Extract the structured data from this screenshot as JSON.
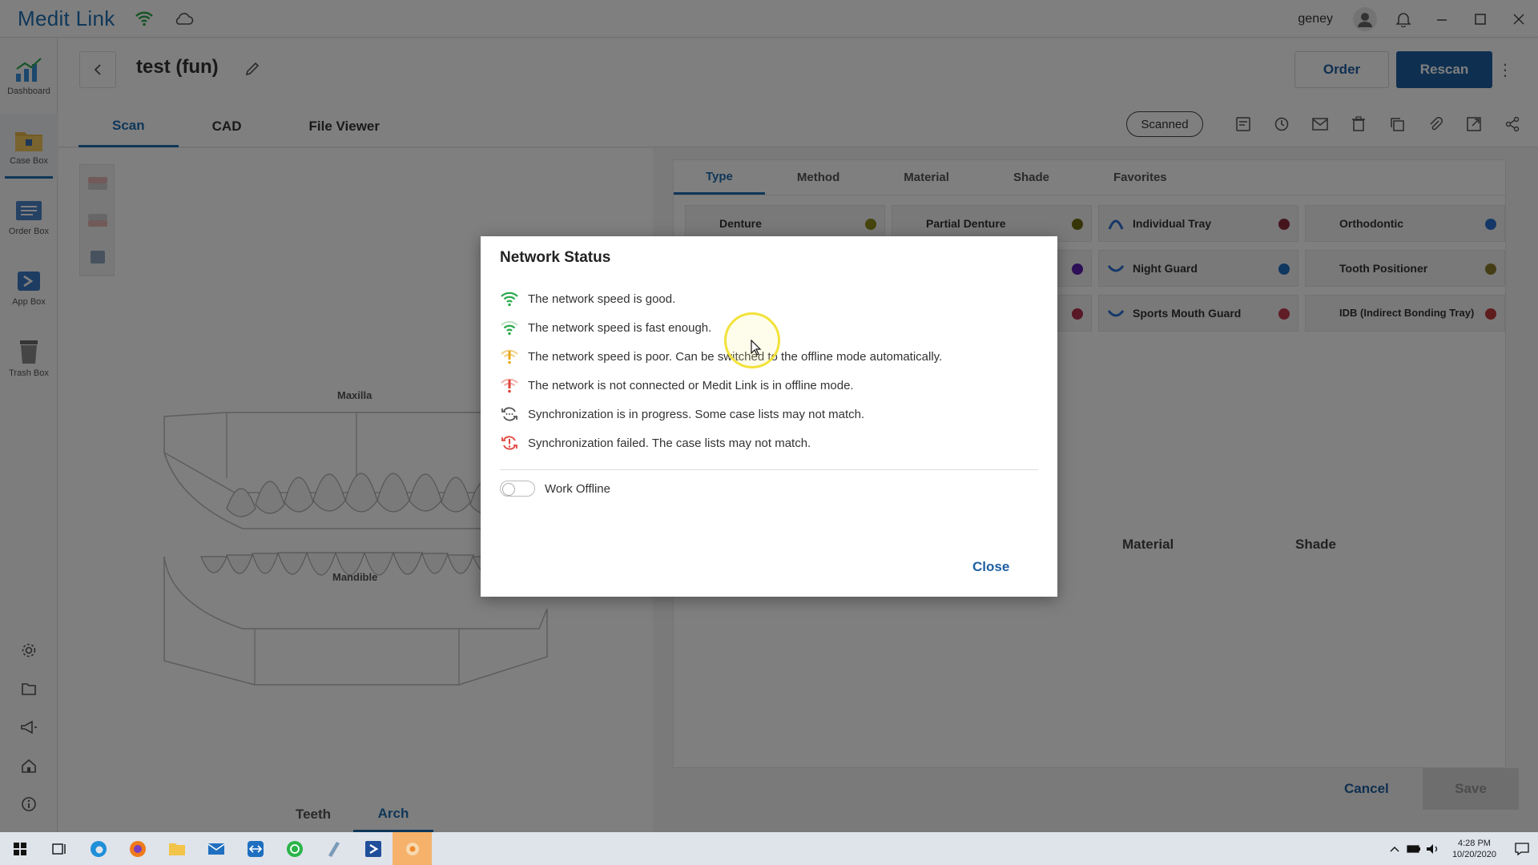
{
  "app": {
    "title": "Medit Link",
    "user": "geney"
  },
  "colors": {
    "accent": "#1f6fb2",
    "primary_button": "#1f5fa0",
    "good": "#2aa84a",
    "warn": "#e8a81b",
    "error": "#e0443c"
  },
  "rail": {
    "items": [
      {
        "label": "Dashboard",
        "icon": "dashboard-icon"
      },
      {
        "label": "Case Box",
        "icon": "case-box-icon"
      },
      {
        "label": "Order Box",
        "icon": "order-box-icon"
      },
      {
        "label": "App Box",
        "icon": "app-box-icon"
      },
      {
        "label": "Trash Box",
        "icon": "trash-box-icon"
      }
    ]
  },
  "case": {
    "title": "test (fun)",
    "order_label": "Order",
    "rescan_label": "Rescan",
    "status": "Scanned",
    "tabs": [
      "Scan",
      "CAD",
      "File Viewer"
    ]
  },
  "scan_view": {
    "maxilla_label": "Maxilla",
    "mandible_label": "Mandible",
    "bottom_tabs": [
      "Teeth",
      "Arch"
    ]
  },
  "form": {
    "type_tabs": [
      "Type",
      "Method",
      "Material",
      "Shade",
      "Favorites"
    ],
    "types": [
      {
        "label": "Denture",
        "dot": "#8a8a1a"
      },
      {
        "label": "Partial Denture",
        "dot": "#6a6a10"
      },
      {
        "label": "Individual Tray",
        "dot": "#8a2a3a"
      },
      {
        "label": "Orthodontic",
        "dot": "#2a6fd0"
      },
      {
        "label": "",
        "dot": "#5a1fb0"
      },
      {
        "label": "Night Guard",
        "dot": "#1f6fc0"
      },
      {
        "label": "Tooth Positioner",
        "dot": "#8a7a2a"
      },
      {
        "label": "",
        "dot": "#b0304a"
      },
      {
        "label": "Sports Mouth Guard",
        "dot": "#c03a4a"
      },
      {
        "label": "IDB (Indirect Bonding Tray)",
        "dot": "#c03a3a"
      }
    ],
    "col_material": "Material",
    "col_shade": "Shade",
    "cancel_label": "Cancel",
    "save_label": "Save"
  },
  "modal": {
    "title": "Network Status",
    "rows": [
      {
        "text": "The network speed is good.",
        "icon": "wifi-good-icon"
      },
      {
        "text": "The network speed is fast enough.",
        "icon": "wifi-fast-icon"
      },
      {
        "text": "The network speed is poor. Can be switched to the offline mode automatically.",
        "icon": "wifi-poor-icon"
      },
      {
        "text": "The network is not connected or Medit Link is in offline mode.",
        "icon": "wifi-offline-icon"
      },
      {
        "text": "Synchronization is in progress. Some case lists may not match.",
        "icon": "sync-progress-icon"
      },
      {
        "text": "Synchronization failed. The case lists may not match.",
        "icon": "sync-failed-icon"
      }
    ],
    "toggle_label": "Work Offline",
    "toggle_on": false,
    "close_label": "Close"
  },
  "taskbar": {
    "time": "4:28 PM",
    "date": "10/20/2020"
  }
}
